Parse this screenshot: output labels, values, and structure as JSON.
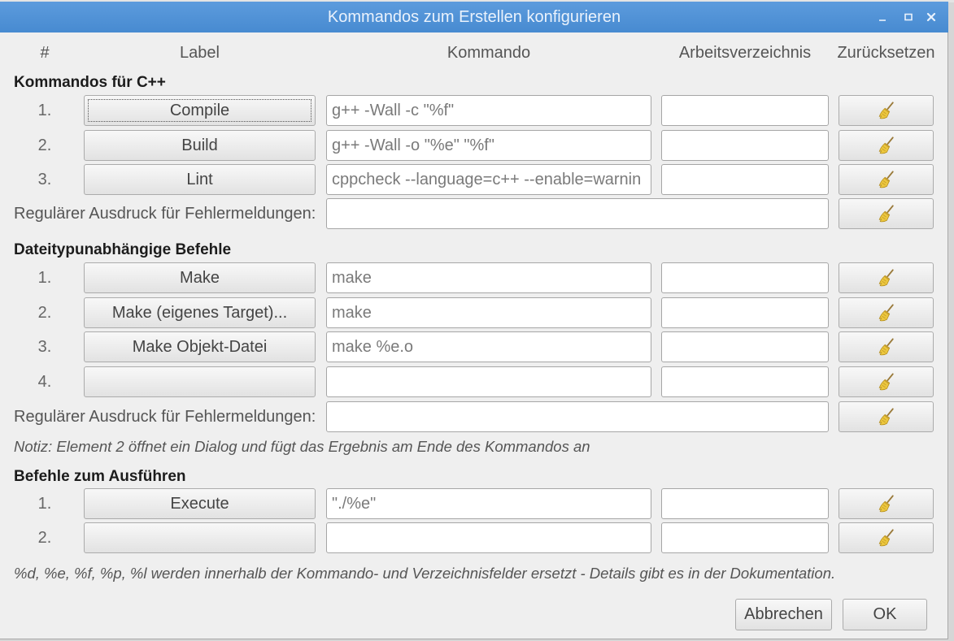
{
  "window": {
    "title": "Kommandos zum Erstellen konfigurieren",
    "controls": [
      "minimize-icon",
      "maximize-icon",
      "close-icon"
    ]
  },
  "columns": {
    "number": "#",
    "label": "Label",
    "command": "Kommando",
    "workdir": "Arbeitsverzeichnis",
    "reset": "Zurücksetzen"
  },
  "sections": [
    {
      "title": "Kommandos für C++",
      "rows": [
        {
          "number": "1.",
          "label": "Compile",
          "command": "g++ -Wall -c \"%f\"",
          "workdir": ""
        },
        {
          "number": "2.",
          "label": "Build",
          "command": "g++ -Wall -o \"%e\" \"%f\"",
          "workdir": ""
        },
        {
          "number": "3.",
          "label": "Lint",
          "command": "cppcheck --language=c++ --enable=warnin",
          "workdir": ""
        }
      ],
      "regex": {
        "label": "Regulärer Ausdruck für Fehlermeldungen:",
        "value": ""
      }
    },
    {
      "title": "Dateitypunabhängige Befehle",
      "rows": [
        {
          "number": "1.",
          "label": "Make",
          "command": "make",
          "workdir": ""
        },
        {
          "number": "2.",
          "label": "Make (eigenes Target)...",
          "command": "make",
          "workdir": ""
        },
        {
          "number": "3.",
          "label": "Make Objekt-Datei",
          "command": "make %e.o",
          "workdir": ""
        },
        {
          "number": "4.",
          "label": "",
          "command": "",
          "workdir": ""
        }
      ],
      "regex": {
        "label": "Regulärer Ausdruck für Fehlermeldungen:",
        "value": ""
      },
      "note": "Notiz: Element 2 öffnet ein Dialog und fügt das Ergebnis am Ende des Kommandos an"
    },
    {
      "title": "Befehle zum Ausführen",
      "rows": [
        {
          "number": "1.",
          "label": "Execute",
          "command": "\"./%e\"",
          "workdir": ""
        },
        {
          "number": "2.",
          "label": "",
          "command": "",
          "workdir": ""
        }
      ]
    }
  ],
  "footer_note": "%d, %e, %f, %p, %l werden innerhalb der Kommando- und Verzeichnisfelder ersetzt - Details gibt es in der Dokumentation.",
  "buttons": {
    "cancel": "Abbrechen",
    "ok": "OK"
  },
  "icons": {
    "reset": "broom-icon"
  },
  "colors": {
    "title_bar": "#4a90d9",
    "title_text": "#eaf2fc",
    "dialog_background": "#efefef",
    "broom": "#ecc73e"
  }
}
